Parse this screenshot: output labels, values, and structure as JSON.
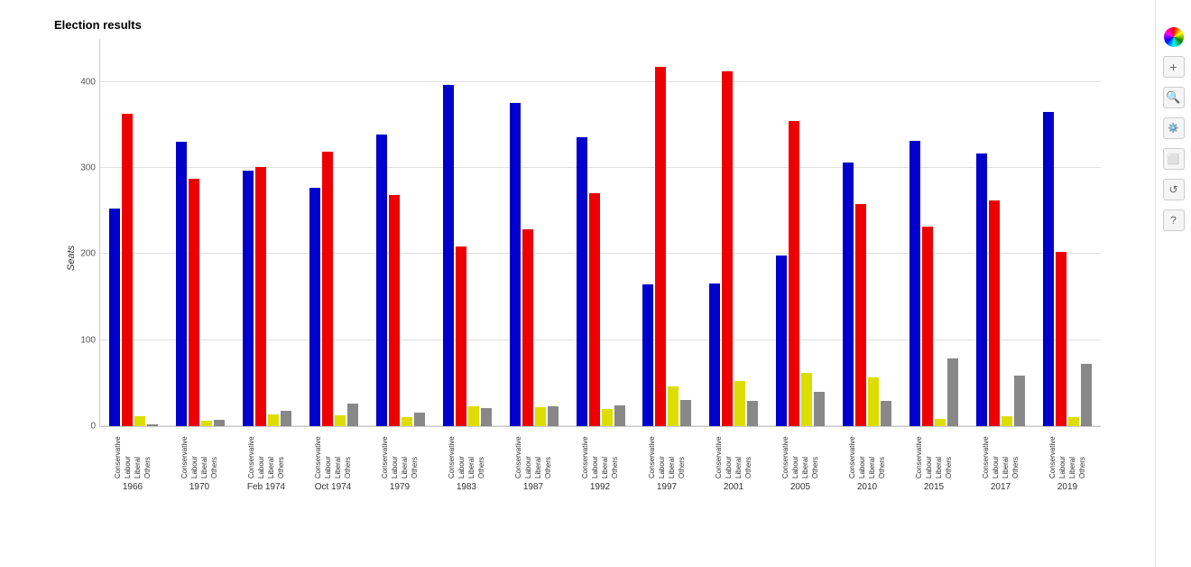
{
  "title": "Election results",
  "yAxisLabel": "Seats",
  "yTicks": [
    0,
    100,
    200,
    300,
    400
  ],
  "maxValue": 450,
  "colors": {
    "conservative": "#0000ff",
    "labour": "#ff0000",
    "liberal": "#ffff00",
    "others": "#888888"
  },
  "elections": [
    {
      "year": "1966",
      "conservative": 253,
      "labour": 363,
      "liberal": 12,
      "others": 2
    },
    {
      "year": "1970",
      "conservative": 330,
      "labour": 287,
      "liberal": 6,
      "others": 7
    },
    {
      "year": "Feb 1974",
      "conservative": 297,
      "labour": 301,
      "liberal": 14,
      "others": 18
    },
    {
      "year": "Oct 1974",
      "conservative": 277,
      "labour": 319,
      "liberal": 13,
      "others": 26
    },
    {
      "year": "1979",
      "conservative": 339,
      "labour": 269,
      "liberal": 11,
      "others": 16
    },
    {
      "year": "1983",
      "conservative": 397,
      "labour": 209,
      "liberal": 23,
      "others": 21
    },
    {
      "year": "1987",
      "conservative": 376,
      "labour": 229,
      "liberal": 22,
      "others": 23
    },
    {
      "year": "1992",
      "conservative": 336,
      "labour": 271,
      "liberal": 20,
      "others": 24
    },
    {
      "year": "1997",
      "conservative": 165,
      "labour": 418,
      "liberal": 46,
      "others": 30
    },
    {
      "year": "2001",
      "conservative": 166,
      "labour": 412,
      "liberal": 52,
      "others": 29
    },
    {
      "year": "2005",
      "conservative": 198,
      "labour": 355,
      "liberal": 62,
      "others": 40
    },
    {
      "year": "2010",
      "conservative": 306,
      "labour": 258,
      "liberal": 57,
      "others": 29
    },
    {
      "year": "2015",
      "conservative": 331,
      "labour": 232,
      "liberal": 8,
      "others": 79
    },
    {
      "year": "2017",
      "conservative": 317,
      "labour": 262,
      "liberal": 12,
      "others": 59
    },
    {
      "year": "2019",
      "conservative": 365,
      "labour": 202,
      "liberal": 11,
      "others": 72
    }
  ],
  "partyLabels": [
    "Conservative",
    "Labour",
    "Liberal",
    "Others"
  ],
  "toolbar": {
    "icons": [
      "colorwheel",
      "zoom-in",
      "search",
      "reset",
      "frame",
      "refresh",
      "help"
    ]
  }
}
